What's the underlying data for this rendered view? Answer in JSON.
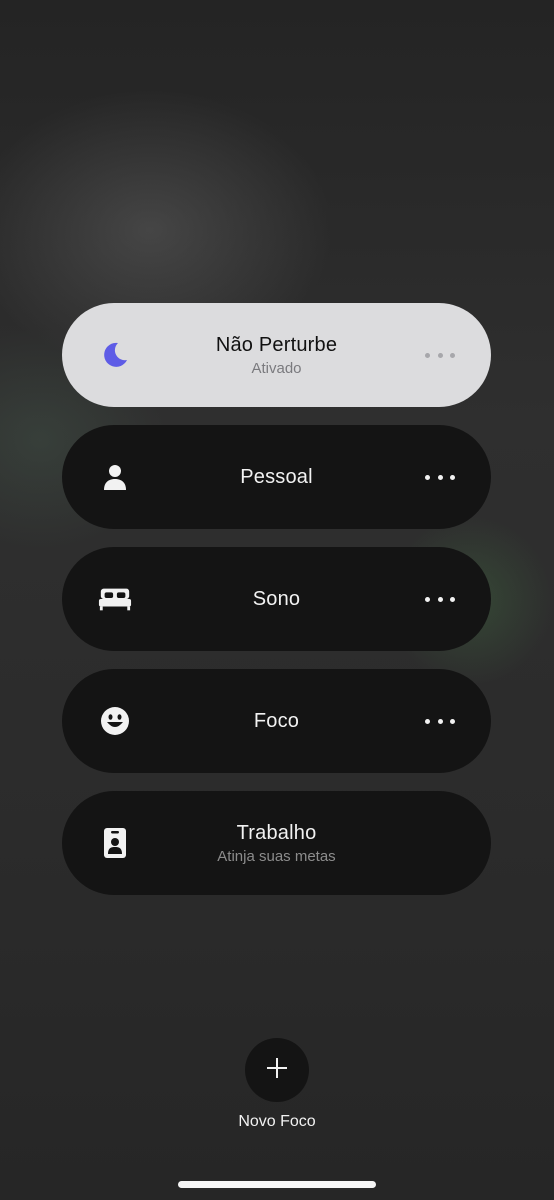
{
  "focus_modes": [
    {
      "title": "Não Perturbe",
      "subtitle": "Ativado",
      "icon": "moon-icon",
      "active": true,
      "icon_color": "#5e5ce6"
    },
    {
      "title": "Pessoal",
      "subtitle": "",
      "icon": "person-icon",
      "active": false
    },
    {
      "title": "Sono",
      "subtitle": "",
      "icon": "bed-icon",
      "active": false
    },
    {
      "title": "Foco",
      "subtitle": "",
      "icon": "smiley-icon",
      "active": false
    },
    {
      "title": "Trabalho",
      "subtitle": "Atinja suas metas",
      "icon": "id-badge-icon",
      "active": false
    }
  ],
  "new_focus": {
    "label": "Novo Foco",
    "icon": "plus-icon"
  }
}
